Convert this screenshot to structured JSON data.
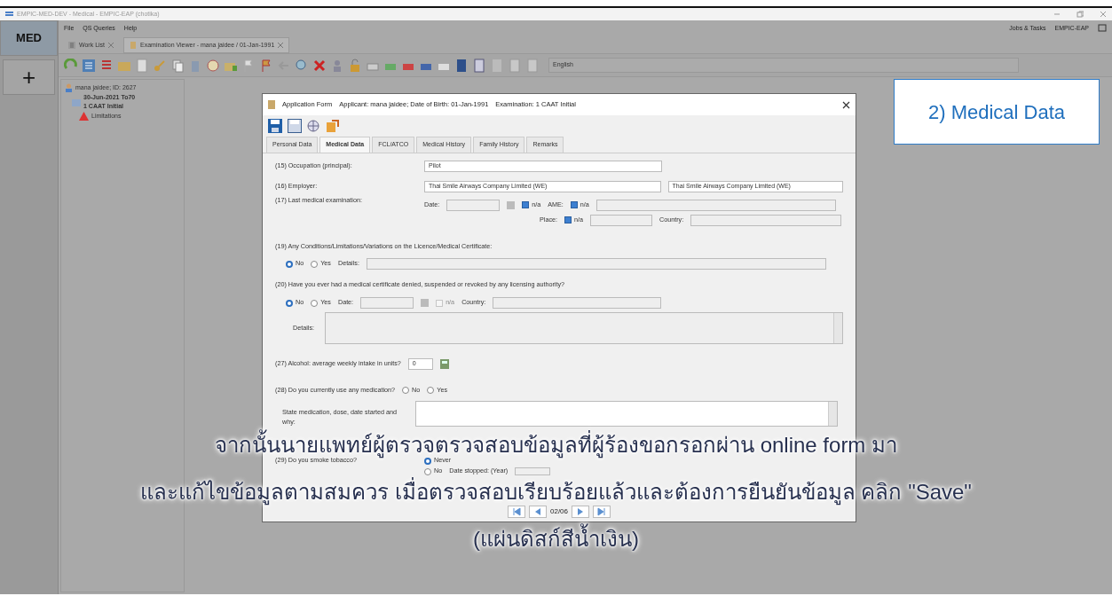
{
  "window": {
    "title": "EMPIC-MED-DEV - Medical - EMPIC-EAP (chotika)"
  },
  "modules": [
    {
      "label": "MED",
      "selected": true
    },
    {
      "label": "+",
      "selected": false
    }
  ],
  "menu": [
    "File",
    "QS Queries",
    "Help"
  ],
  "header_right": [
    "Jobs & Tasks",
    "EMPIC-EAP"
  ],
  "tabs": [
    {
      "label": "Work List",
      "selected": false
    },
    {
      "label": "Examination Viewer - mana jaidee / 01-Jan-1991",
      "selected": true
    }
  ],
  "toolbar": {
    "language": "English"
  },
  "tree": {
    "label": "mana jaidee; ID: 2627",
    "children": [
      {
        "label": "30-Jun-2021 To70",
        "sublabel": "1 CAAT Initial",
        "children": [
          {
            "label": "Limitations"
          }
        ]
      }
    ]
  },
  "callout": "2) Medical Data",
  "dialog": {
    "title": "Application Form",
    "applicant": "Applicant: mana jaidee; Date of Birth: 01-Jan-1991",
    "examination": "Examination: 1 CAAT Initial",
    "tabs": [
      {
        "label": "Personal Data",
        "selected": false
      },
      {
        "label": "Medical Data",
        "selected": true
      },
      {
        "label": "FCL/ATCO",
        "selected": false
      },
      {
        "label": "Medical History",
        "selected": false
      },
      {
        "label": "Family History",
        "selected": false
      },
      {
        "label": "Remarks",
        "selected": false
      }
    ],
    "occupation": {
      "label": "(15) Occupation (principal):",
      "value": "Pilot"
    },
    "employer": {
      "label": "(16) Employer:",
      "value": "Thai Smile Airways Company Limited (WE)",
      "value2": "Thai Smile Airways Company Limited (WE)"
    },
    "last_exam": {
      "label": "(17) Last medical examination:",
      "date_label": "Date:",
      "date_na": {
        "label": "n/a",
        "checked": true
      },
      "ame_label": "AME:",
      "ame_na": {
        "label": "n/a",
        "checked": true
      },
      "place_label": "Place:",
      "place_na": {
        "label": "n/a",
        "checked": true
      },
      "country_label": "Country:"
    },
    "q19": {
      "label": "(19) Any Conditions/Limitations/Variations on the Licence/Medical Certificate:",
      "options": [
        {
          "label": "No",
          "selected": true
        },
        {
          "label": "Yes",
          "selected": false
        }
      ],
      "details_label": "Details:"
    },
    "q20": {
      "label": "(20) Have you ever had a medical certificate denied, suspended or revoked by any licensing authority?",
      "options": [
        {
          "label": "No",
          "selected": true
        },
        {
          "label": "Yes",
          "selected": false
        }
      ],
      "date_label": "Date:",
      "na": {
        "label": "n/a",
        "checked": false,
        "disabled": true
      },
      "country_label": "Country:",
      "details_label": "Details:"
    },
    "q27": {
      "label": "(27) Alcohol: average weekly intake in units?",
      "value": "0"
    },
    "q28": {
      "label": "(28) Do you currently use any medication?",
      "options": [
        {
          "label": "No",
          "selected": false
        },
        {
          "label": "Yes",
          "selected": false
        }
      ],
      "details_label": "State medication, dose, date started and why:"
    },
    "q29": {
      "label": "(29) Do you smoke tobacco?",
      "options": [
        {
          "label": "Never",
          "selected": true
        },
        {
          "label": "No",
          "selected": false
        }
      ],
      "stopped_label": "Date stopped: (Year)"
    },
    "pager": "02/06"
  },
  "subtitles": [
    "จากนั้นนายแพทย์ผู้ตรวจตรวจสอบข้อมูลที่ผู้ร้องขอกรอกผ่าน online form มา",
    "และแก้ไขข้อมูลตามสมควร เมื่อตรวจสอบเรียบร้อยแล้วและต้องการยืนยันข้อมูล คลิก \"Save\"",
    "(แผ่นดิสก์สีน้ำเงิน)"
  ]
}
